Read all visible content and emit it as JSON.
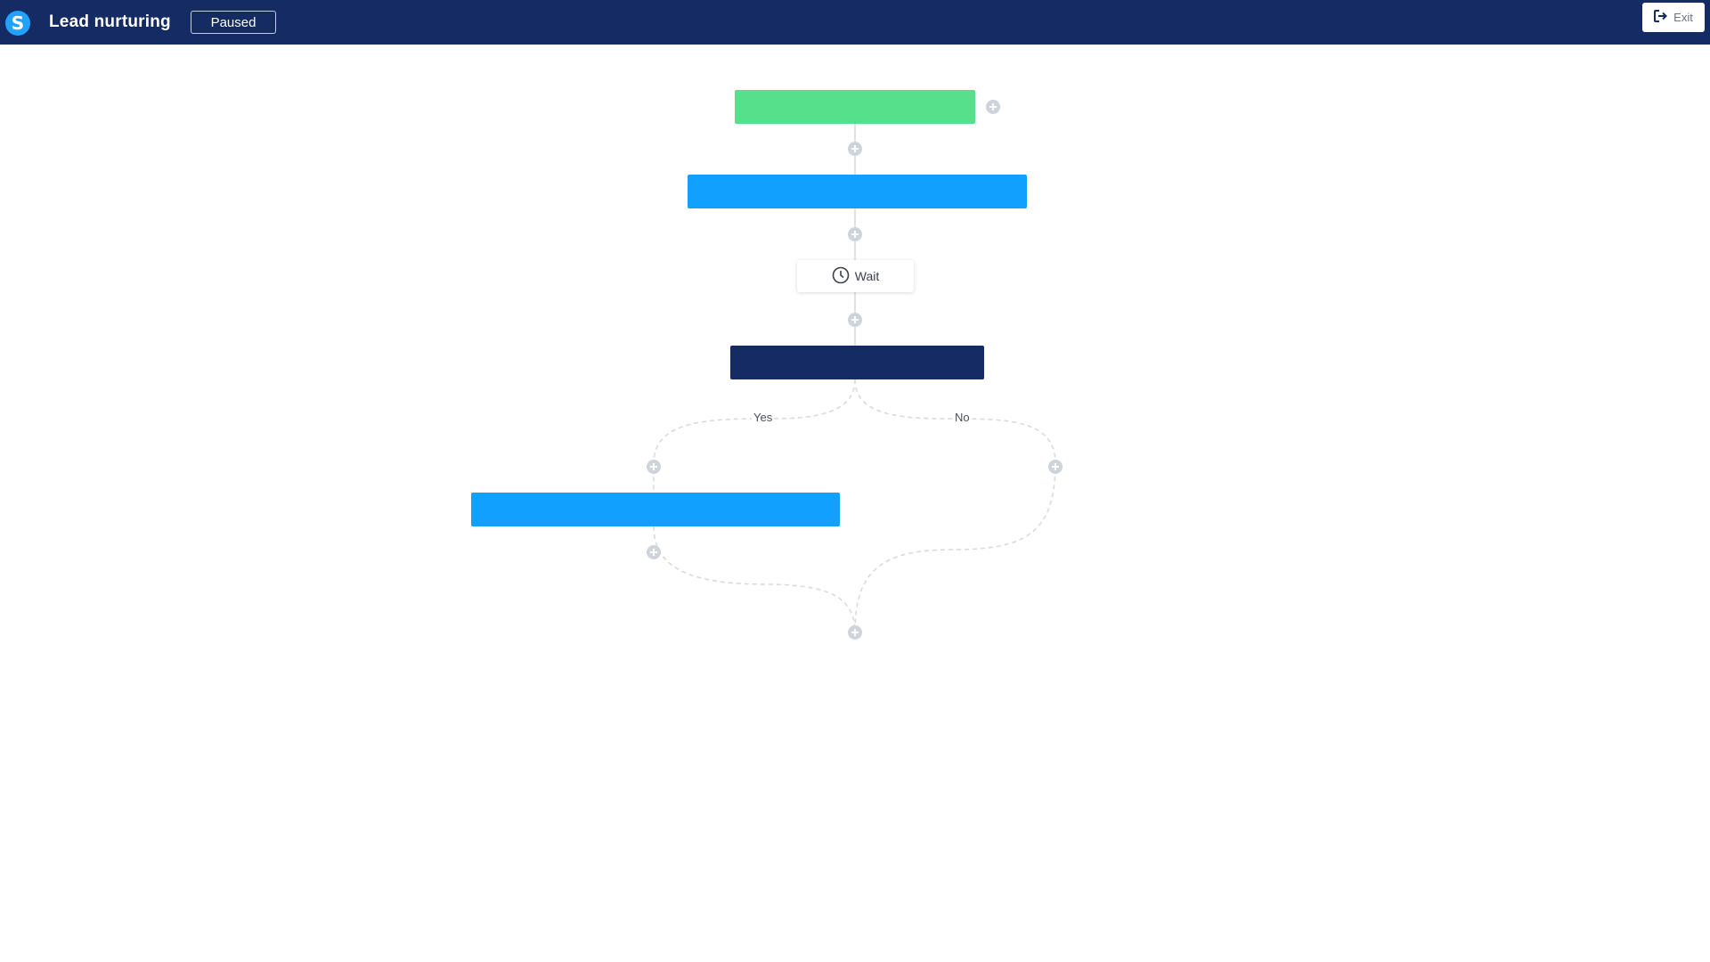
{
  "header": {
    "logo_letter": "S",
    "title": "Lead nurturing",
    "status": "Paused",
    "exit_label": "Exit",
    "background_color": "#142b63"
  },
  "workflow": {
    "wait_label": "Wait",
    "branch_yes": "Yes",
    "branch_no": "No",
    "colors": {
      "trigger": "#56e08c",
      "action": "#12a0ff",
      "condition": "#142b63",
      "connector": "#cfd3da"
    },
    "icons": {
      "add": "plus-circle-icon",
      "wait": "clock-icon",
      "exit": "sign-out-icon"
    }
  }
}
